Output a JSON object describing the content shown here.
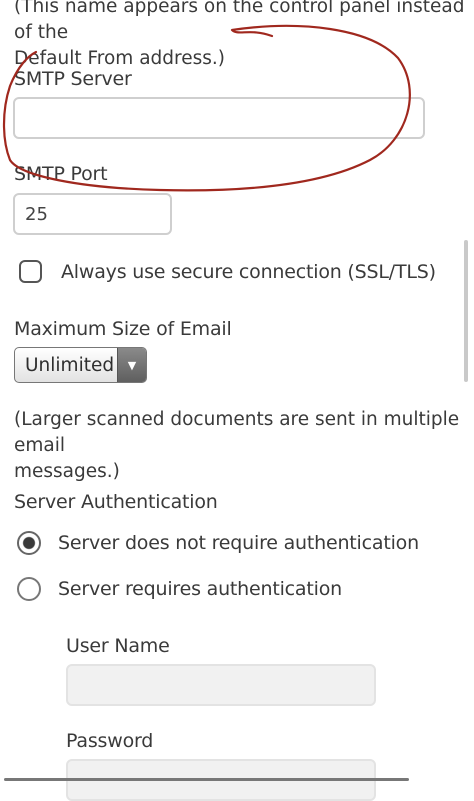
{
  "smtp": {
    "from_note_line1": "(This name appears on the control panel instead of the",
    "from_note_line2": "Default From address.)",
    "server_label": "SMTP Server",
    "server_value": "",
    "port_label": "SMTP Port",
    "port_value": "25",
    "ssl_label": "Always use secure connection (SSL/TLS)",
    "ssl_checked": false
  },
  "email_size": {
    "label": "Maximum Size of Email",
    "selected": "Unlimited",
    "note_line1": "(Larger scanned documents are sent in multiple email",
    "note_line2": "messages.)"
  },
  "auth": {
    "label": "Server Authentication",
    "options": [
      {
        "label": "Server does not require authentication",
        "checked": true
      },
      {
        "label": "Server requires authentication",
        "checked": false
      }
    ],
    "username_label": "User Name",
    "username_value": "",
    "password_label": "Password",
    "password_value": ""
  },
  "annotation": {
    "color": "#a0281e",
    "shape": "hand-drawn oval around SMTP Server field"
  }
}
